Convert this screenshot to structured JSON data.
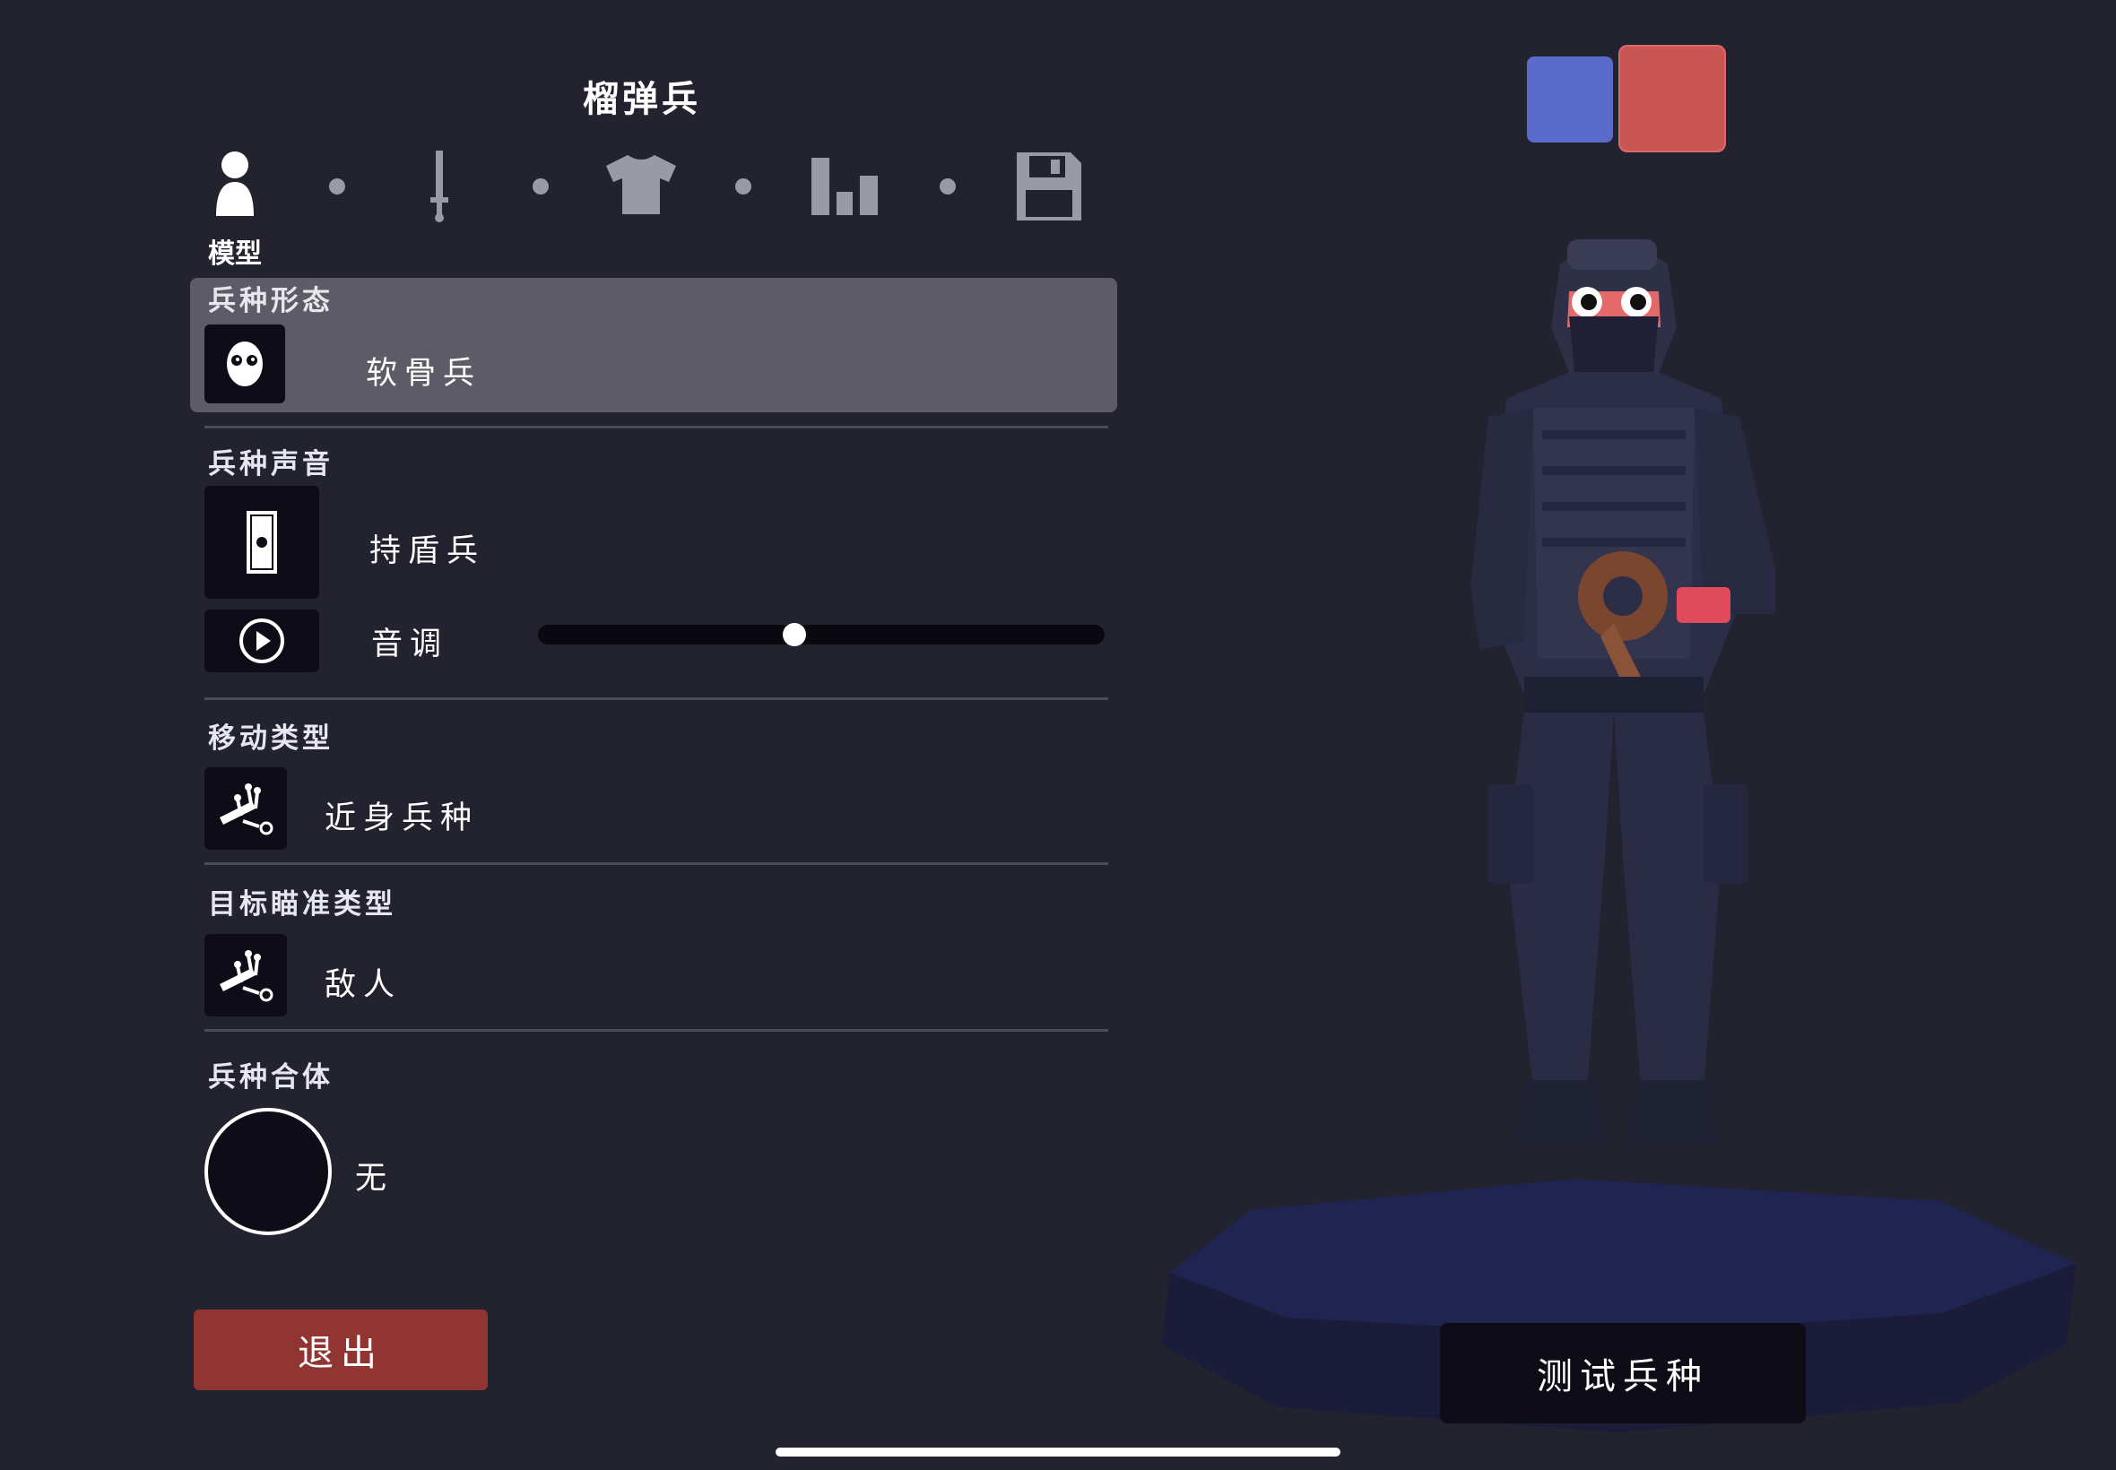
{
  "header": {
    "title": "榴弹兵"
  },
  "tabs": [
    {
      "name": "model",
      "label": "模型",
      "icon": "person-icon",
      "active": true
    },
    {
      "name": "weapon",
      "icon": "sword-icon"
    },
    {
      "name": "clothing",
      "icon": "shirt-icon"
    },
    {
      "name": "stats",
      "icon": "bar-chart-icon"
    },
    {
      "name": "save",
      "icon": "floppy-disk-icon"
    }
  ],
  "sections": {
    "form": {
      "label": "兵种形态",
      "value": "软骨兵",
      "icon": "face-icon"
    },
    "voice": {
      "label": "兵种声音",
      "value": "持盾兵",
      "icon": "shield-icon",
      "pitch_label": "音调",
      "pitch_level": 0.45,
      "play_icon": "play-icon"
    },
    "movement": {
      "label": "移动类型",
      "value": "近身兵种",
      "icon": "melee-icon"
    },
    "targeting": {
      "label": "目标瞄准类型",
      "value": "敌人",
      "icon": "melee-icon"
    },
    "combination": {
      "label": "兵种合体",
      "value": "无"
    }
  },
  "buttons": {
    "exit": "退出",
    "test": "测试兵种"
  },
  "teams": {
    "blue": "#5a6bca",
    "red": "#c95555"
  },
  "colors": {
    "background": "#23222f",
    "exit": "#913533",
    "panel_selected": "#5d5c66"
  }
}
